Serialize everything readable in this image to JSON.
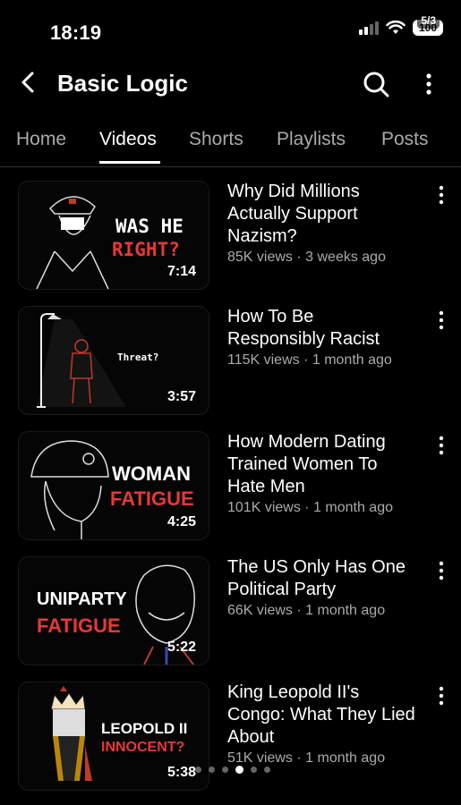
{
  "status": {
    "time": "18:19",
    "battery": "100",
    "image_counter": "5/3"
  },
  "header": {
    "title": "Basic Logic"
  },
  "tabs": [
    {
      "label": "Home"
    },
    {
      "label": "Videos"
    },
    {
      "label": "Shorts"
    },
    {
      "label": "Playlists"
    },
    {
      "label": "Posts"
    }
  ],
  "videos": [
    {
      "thumb_text_1": "WAS HE",
      "thumb_text_2": "RIGHT?",
      "duration": "7:14",
      "title": "Why Did Millions Actually Support Nazism?",
      "views": "85K views",
      "age": "3 weeks ago",
      "sub": "85K views · 3 weeks ago"
    },
    {
      "thumb_text_1": "Threat?",
      "duration": "3:57",
      "title": "How To Be Responsibly Racist",
      "views": "115K views",
      "age": "1 month ago",
      "sub": "115K views · 1 month ago"
    },
    {
      "thumb_text_1": "WOMAN",
      "thumb_text_2": "FATIGUE",
      "duration": "4:25",
      "title": "How Modern Dating Trained Women To Hate Men",
      "views": "101K views",
      "age": "1 month ago",
      "sub": "101K views · 1 month ago"
    },
    {
      "thumb_text_1": "UNIPARTY",
      "thumb_text_2": "FATIGUE",
      "duration": "5:22",
      "title": "The US Only Has One Political Party",
      "views": "66K views",
      "age": "1 month ago",
      "sub": "66K views · 1 month ago"
    },
    {
      "thumb_text_1": "LEOPOLD II",
      "thumb_text_2": "INNOCENT?",
      "duration": "5:38",
      "title": "King Leopold II's Congo: What They Lied About",
      "views": "51K views",
      "age": "1 month ago",
      "sub": "51K views · 1 month ago"
    }
  ],
  "colors": {
    "accent_red": "#e53935",
    "text_secondary": "#aaaaaa"
  }
}
